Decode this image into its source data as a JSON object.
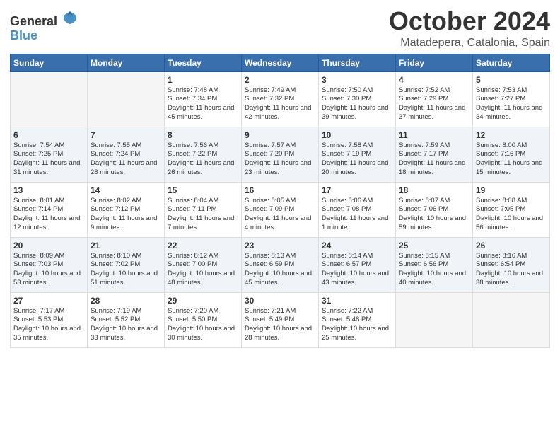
{
  "logo": {
    "general": "General",
    "blue": "Blue"
  },
  "title": "October 2024",
  "location": "Matadepera, Catalonia, Spain",
  "days_of_week": [
    "Sunday",
    "Monday",
    "Tuesday",
    "Wednesday",
    "Thursday",
    "Friday",
    "Saturday"
  ],
  "weeks": [
    [
      {
        "day": null
      },
      {
        "day": null
      },
      {
        "day": "1",
        "sunrise": "Sunrise: 7:48 AM",
        "sunset": "Sunset: 7:34 PM",
        "daylight": "Daylight: 11 hours and 45 minutes."
      },
      {
        "day": "2",
        "sunrise": "Sunrise: 7:49 AM",
        "sunset": "Sunset: 7:32 PM",
        "daylight": "Daylight: 11 hours and 42 minutes."
      },
      {
        "day": "3",
        "sunrise": "Sunrise: 7:50 AM",
        "sunset": "Sunset: 7:30 PM",
        "daylight": "Daylight: 11 hours and 39 minutes."
      },
      {
        "day": "4",
        "sunrise": "Sunrise: 7:52 AM",
        "sunset": "Sunset: 7:29 PM",
        "daylight": "Daylight: 11 hours and 37 minutes."
      },
      {
        "day": "5",
        "sunrise": "Sunrise: 7:53 AM",
        "sunset": "Sunset: 7:27 PM",
        "daylight": "Daylight: 11 hours and 34 minutes."
      }
    ],
    [
      {
        "day": "6",
        "sunrise": "Sunrise: 7:54 AM",
        "sunset": "Sunset: 7:25 PM",
        "daylight": "Daylight: 11 hours and 31 minutes."
      },
      {
        "day": "7",
        "sunrise": "Sunrise: 7:55 AM",
        "sunset": "Sunset: 7:24 PM",
        "daylight": "Daylight: 11 hours and 28 minutes."
      },
      {
        "day": "8",
        "sunrise": "Sunrise: 7:56 AM",
        "sunset": "Sunset: 7:22 PM",
        "daylight": "Daylight: 11 hours and 26 minutes."
      },
      {
        "day": "9",
        "sunrise": "Sunrise: 7:57 AM",
        "sunset": "Sunset: 7:20 PM",
        "daylight": "Daylight: 11 hours and 23 minutes."
      },
      {
        "day": "10",
        "sunrise": "Sunrise: 7:58 AM",
        "sunset": "Sunset: 7:19 PM",
        "daylight": "Daylight: 11 hours and 20 minutes."
      },
      {
        "day": "11",
        "sunrise": "Sunrise: 7:59 AM",
        "sunset": "Sunset: 7:17 PM",
        "daylight": "Daylight: 11 hours and 18 minutes."
      },
      {
        "day": "12",
        "sunrise": "Sunrise: 8:00 AM",
        "sunset": "Sunset: 7:16 PM",
        "daylight": "Daylight: 11 hours and 15 minutes."
      }
    ],
    [
      {
        "day": "13",
        "sunrise": "Sunrise: 8:01 AM",
        "sunset": "Sunset: 7:14 PM",
        "daylight": "Daylight: 11 hours and 12 minutes."
      },
      {
        "day": "14",
        "sunrise": "Sunrise: 8:02 AM",
        "sunset": "Sunset: 7:12 PM",
        "daylight": "Daylight: 11 hours and 9 minutes."
      },
      {
        "day": "15",
        "sunrise": "Sunrise: 8:04 AM",
        "sunset": "Sunset: 7:11 PM",
        "daylight": "Daylight: 11 hours and 7 minutes."
      },
      {
        "day": "16",
        "sunrise": "Sunrise: 8:05 AM",
        "sunset": "Sunset: 7:09 PM",
        "daylight": "Daylight: 11 hours and 4 minutes."
      },
      {
        "day": "17",
        "sunrise": "Sunrise: 8:06 AM",
        "sunset": "Sunset: 7:08 PM",
        "daylight": "Daylight: 11 hours and 1 minute."
      },
      {
        "day": "18",
        "sunrise": "Sunrise: 8:07 AM",
        "sunset": "Sunset: 7:06 PM",
        "daylight": "Daylight: 10 hours and 59 minutes."
      },
      {
        "day": "19",
        "sunrise": "Sunrise: 8:08 AM",
        "sunset": "Sunset: 7:05 PM",
        "daylight": "Daylight: 10 hours and 56 minutes."
      }
    ],
    [
      {
        "day": "20",
        "sunrise": "Sunrise: 8:09 AM",
        "sunset": "Sunset: 7:03 PM",
        "daylight": "Daylight: 10 hours and 53 minutes."
      },
      {
        "day": "21",
        "sunrise": "Sunrise: 8:10 AM",
        "sunset": "Sunset: 7:02 PM",
        "daylight": "Daylight: 10 hours and 51 minutes."
      },
      {
        "day": "22",
        "sunrise": "Sunrise: 8:12 AM",
        "sunset": "Sunset: 7:00 PM",
        "daylight": "Daylight: 10 hours and 48 minutes."
      },
      {
        "day": "23",
        "sunrise": "Sunrise: 8:13 AM",
        "sunset": "Sunset: 6:59 PM",
        "daylight": "Daylight: 10 hours and 45 minutes."
      },
      {
        "day": "24",
        "sunrise": "Sunrise: 8:14 AM",
        "sunset": "Sunset: 6:57 PM",
        "daylight": "Daylight: 10 hours and 43 minutes."
      },
      {
        "day": "25",
        "sunrise": "Sunrise: 8:15 AM",
        "sunset": "Sunset: 6:56 PM",
        "daylight": "Daylight: 10 hours and 40 minutes."
      },
      {
        "day": "26",
        "sunrise": "Sunrise: 8:16 AM",
        "sunset": "Sunset: 6:54 PM",
        "daylight": "Daylight: 10 hours and 38 minutes."
      }
    ],
    [
      {
        "day": "27",
        "sunrise": "Sunrise: 7:17 AM",
        "sunset": "Sunset: 5:53 PM",
        "daylight": "Daylight: 10 hours and 35 minutes."
      },
      {
        "day": "28",
        "sunrise": "Sunrise: 7:19 AM",
        "sunset": "Sunset: 5:52 PM",
        "daylight": "Daylight: 10 hours and 33 minutes."
      },
      {
        "day": "29",
        "sunrise": "Sunrise: 7:20 AM",
        "sunset": "Sunset: 5:50 PM",
        "daylight": "Daylight: 10 hours and 30 minutes."
      },
      {
        "day": "30",
        "sunrise": "Sunrise: 7:21 AM",
        "sunset": "Sunset: 5:49 PM",
        "daylight": "Daylight: 10 hours and 28 minutes."
      },
      {
        "day": "31",
        "sunrise": "Sunrise: 7:22 AM",
        "sunset": "Sunset: 5:48 PM",
        "daylight": "Daylight: 10 hours and 25 minutes."
      },
      {
        "day": null
      },
      {
        "day": null
      }
    ]
  ]
}
